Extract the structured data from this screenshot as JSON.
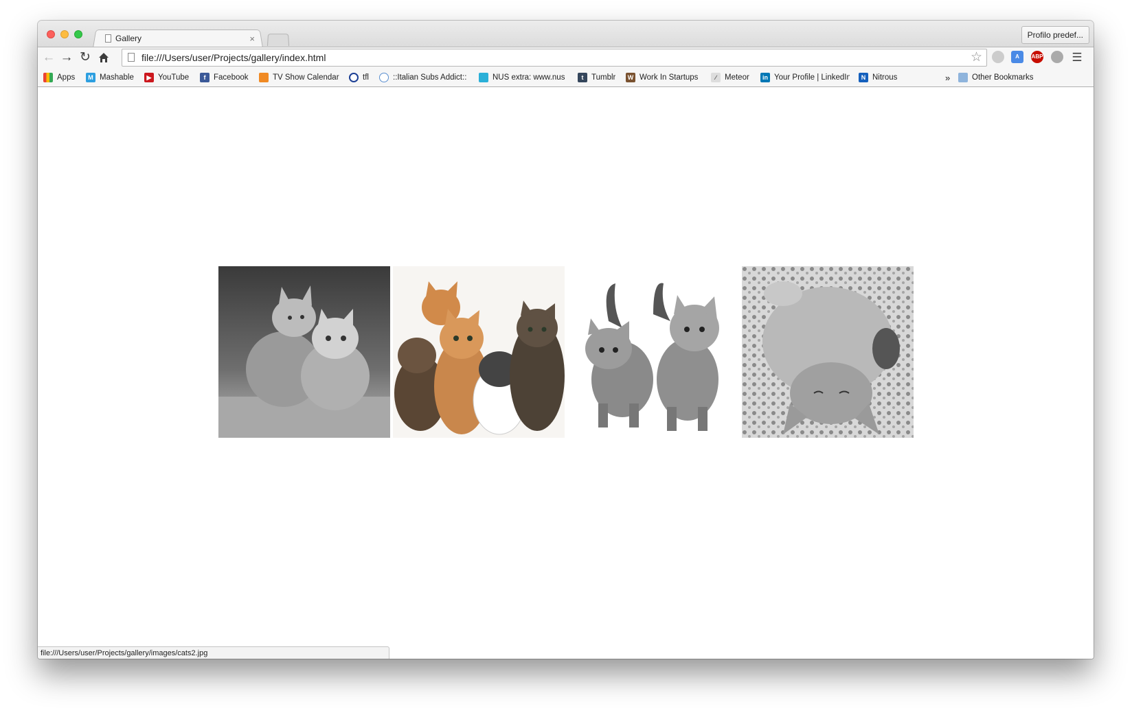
{
  "tab": {
    "title": "Gallery",
    "close": "×"
  },
  "profile_button": "Profilo predef...",
  "omnibox": {
    "url": "file:///Users/user/Projects/gallery/index.html"
  },
  "bookmarks": [
    {
      "label": "Apps",
      "icon": "apps-grid-icon"
    },
    {
      "label": "Mashable",
      "icon": "mashable-icon"
    },
    {
      "label": "YouTube",
      "icon": "youtube-icon"
    },
    {
      "label": "Facebook",
      "icon": "facebook-icon"
    },
    {
      "label": "TV Show Calendar",
      "icon": "tv-show-calendar-icon"
    },
    {
      "label": "tfl",
      "icon": "tfl-roundel-icon"
    },
    {
      "label": "::Italian Subs Addict::",
      "icon": "italian-subs-icon"
    },
    {
      "label": "NUS extra: www.nus",
      "icon": "nus-extra-icon"
    },
    {
      "label": "Tumblr",
      "icon": "tumblr-icon"
    },
    {
      "label": "Work In Startups",
      "icon": "work-in-startups-icon"
    },
    {
      "label": "Meteor",
      "icon": "meteor-icon"
    },
    {
      "label": "Your Profile | LinkedIn",
      "icon": "linkedin-icon"
    },
    {
      "label": "Nitrous",
      "icon": "nitrous-icon"
    }
  ],
  "bookmarks_overflow": "»",
  "other_bookmarks": "Other Bookmarks",
  "gallery": [
    {
      "name": "cats-photo-1",
      "style": "grayscale"
    },
    {
      "name": "cats-photo-2",
      "style": "color"
    },
    {
      "name": "cats-photo-3",
      "style": "grayscale"
    },
    {
      "name": "cats-photo-4",
      "style": "grayscale"
    }
  ],
  "status_bar": "file:///Users/user/Projects/gallery/images/cats2.jpg",
  "colors": {
    "chrome_bg": "#f6f6f6",
    "youtube": "#cc181e",
    "facebook": "#3b5998",
    "linkedin": "#0077b5",
    "abp": "#c70d00"
  }
}
